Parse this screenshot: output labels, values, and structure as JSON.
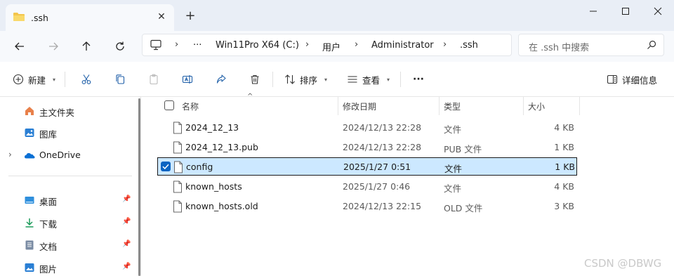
{
  "window": {
    "tab_title": ".ssh",
    "new_tab": "+",
    "close_tab": "✕"
  },
  "address": {
    "ellipsis": "···",
    "crumbs": [
      "Win11Pro X64 (C:)",
      "用户",
      "Administrator",
      ".ssh"
    ],
    "search_placeholder": "在 .ssh 中搜索"
  },
  "commands": {
    "new_label": "新建",
    "sort_label": "排序",
    "view_label": "查看",
    "more_label": "···",
    "details_label": "详细信息"
  },
  "sidebar": {
    "items": [
      {
        "label": "主文件夹",
        "icon": "home-icon"
      },
      {
        "label": "图库",
        "icon": "gallery-icon"
      },
      {
        "label": "OneDrive",
        "icon": "onedrive-icon"
      },
      {
        "label": "桌面",
        "icon": "desktop-icon"
      },
      {
        "label": "下载",
        "icon": "download-icon"
      },
      {
        "label": "文档",
        "icon": "documents-icon"
      },
      {
        "label": "图片",
        "icon": "pictures-icon"
      }
    ]
  },
  "columns": {
    "name": "名称",
    "modified": "修改日期",
    "type": "类型",
    "size": "大小"
  },
  "files": [
    {
      "name": "2024_12_13",
      "modified": "2024/12/13 22:28",
      "type": "文件",
      "size": "4 KB",
      "selected": false
    },
    {
      "name": "2024_12_13.pub",
      "modified": "2024/12/13 22:28",
      "type": "PUB 文件",
      "size": "1 KB",
      "selected": false
    },
    {
      "name": "config",
      "modified": "2025/1/27 0:51",
      "type": "文件",
      "size": "1 KB",
      "selected": true
    },
    {
      "name": "known_hosts",
      "modified": "2025/1/27 0:46",
      "type": "文件",
      "size": "4 KB",
      "selected": false
    },
    {
      "name": "known_hosts.old",
      "modified": "2024/12/13 22:15",
      "type": "OLD 文件",
      "size": "3 KB",
      "selected": false
    }
  ],
  "watermark": "CSDN @DBWG",
  "colors": {
    "accent": "#0a64c2",
    "selection": "#cce8ff",
    "titlebar": "#e9eef6"
  }
}
